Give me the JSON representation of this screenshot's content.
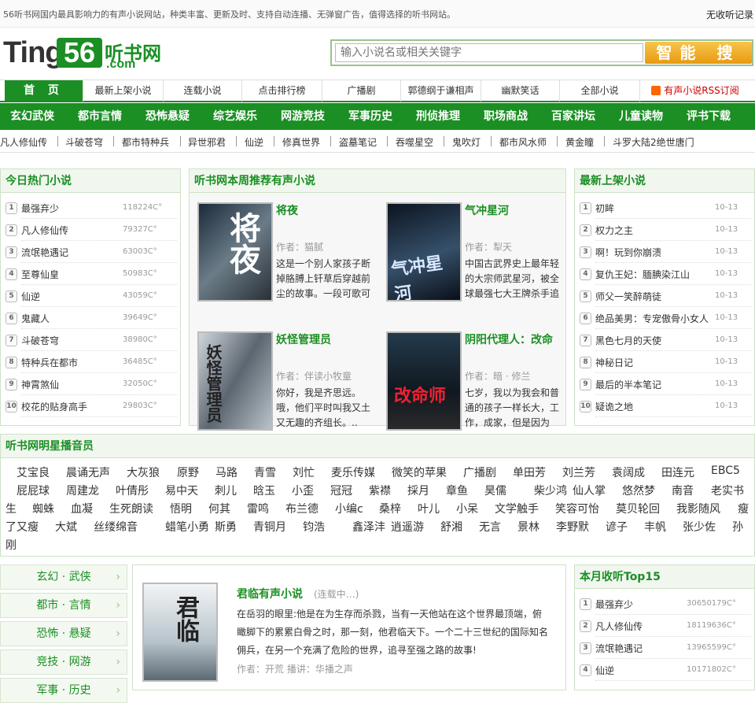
{
  "topbar": {
    "tagline": "56听书网国内最具影响力的有声小说网站，种类丰富、更新及时、支持自动连播、无弹窗广告，值得选择的听书网站。",
    "history": "无收听记录"
  },
  "logo": {
    "ting": "Ting",
    "num": "56",
    "cn": "听书网",
    "com": ".com"
  },
  "search": {
    "placeholder": "输入小说名或相关关键字",
    "button": "智能 搜索"
  },
  "nav_main": [
    "首 页",
    "最新上架小说",
    "连载小说",
    "点击排行榜",
    "广播剧",
    "郭德纲于谦相声",
    "幽默笑话",
    "全部小说",
    "有声小说RSS订阅"
  ],
  "nav_cats": [
    "玄幻武侠",
    "都市言情",
    "恐怖悬疑",
    "综艺娱乐",
    "网游竞技",
    "军事历史",
    "刑侦推理",
    "职场商战",
    "百家讲坛",
    "儿童读物",
    "评书下载"
  ],
  "nav_tags": [
    "凡人修仙传",
    "斗破苍穹",
    "都市特种兵",
    "异世邪君",
    "仙逆",
    "修真世界",
    "盗墓笔记",
    "吞噬星空",
    "鬼吹灯",
    "都市风水师",
    "黄金瞳",
    "斗罗大陆2绝世唐门"
  ],
  "hot": {
    "title": "今日热门小说",
    "items": [
      {
        "n": "1",
        "name": "最强弃少",
        "v": "118224C°"
      },
      {
        "n": "2",
        "name": "凡人修仙传",
        "v": "79327C°"
      },
      {
        "n": "3",
        "name": "流氓艳遇记",
        "v": "63003C°"
      },
      {
        "n": "4",
        "name": "至尊仙皇",
        "v": "50983C°"
      },
      {
        "n": "5",
        "name": "仙逆",
        "v": "43059C°"
      },
      {
        "n": "6",
        "name": "鬼藏人",
        "v": "39649C°"
      },
      {
        "n": "7",
        "name": "斗破苍穹",
        "v": "38980C°"
      },
      {
        "n": "8",
        "name": "特种兵在都市",
        "v": "36485C°"
      },
      {
        "n": "9",
        "name": "神霄煞仙",
        "v": "32050C°"
      },
      {
        "n": "10",
        "name": "校花的贴身高手",
        "v": "29803C°"
      }
    ]
  },
  "week": {
    "title": "听书网本周推荐有声小说",
    "books": [
      {
        "title": "将夜",
        "author": "作者：猫腻",
        "desc": "这是一个别人家孩子断掉胳膊上钎草后穿越前尘的故事。一段可歌可泣可笑可爱...",
        "cover_text": "将夜"
      },
      {
        "title": "气冲星河",
        "author": "作者：犁天",
        "desc": "中国古武界史上最年轻的大宗师武星河，被全球最强七大王牌杀手追杀，误中...",
        "cover_text": "气冲星河"
      },
      {
        "title": "妖怪管理员",
        "author": "作者：伴读小牧童",
        "desc": "你好，我是齐思远。哦，他们平时叫我又土又无趣的齐组长。..",
        "cover_text": "妖怪管理员"
      },
      {
        "title": "阴阳代理人：改命",
        "author": "作者：暗 · 修兰",
        "desc": "七岁，我以为我会和普通的孩子一样长大，工作，成家，但是因为误...",
        "cover_text": "改命师"
      }
    ]
  },
  "newest": {
    "title": "最新上架小说",
    "items": [
      {
        "n": "1",
        "name": "初眸",
        "v": "10-13"
      },
      {
        "n": "2",
        "name": "权力之主",
        "v": "10-13"
      },
      {
        "n": "3",
        "name": "啊！玩到你崩溃",
        "v": "10-13"
      },
      {
        "n": "4",
        "name": "复仇王妃：腼腆染江山",
        "v": "10-13"
      },
      {
        "n": "5",
        "name": "师父一笑醉萌徒",
        "v": "10-13"
      },
      {
        "n": "6",
        "name": "绝品美男：专宠傲骨小女人",
        "v": "10-13"
      },
      {
        "n": "7",
        "name": "黑色七月的天使",
        "v": "10-13"
      },
      {
        "n": "8",
        "name": "神秘日记",
        "v": "10-13"
      },
      {
        "n": "9",
        "name": "最后的半本笔记",
        "v": "10-13"
      },
      {
        "n": "10",
        "name": "疑诡之地",
        "v": "10-13"
      }
    ]
  },
  "stars": {
    "title": "听书网明星播音员",
    "names": [
      "艾宝良",
      "晨诵无声",
      "大灰狼",
      "原野",
      "马路",
      "青雪",
      "刘忙",
      "麦乐传媒",
      "微笑的苹果",
      "广播剧",
      "单田芳",
      "刘兰芳",
      "袁阔成",
      "田连元",
      "EBC5",
      "屁屁球",
      "周建龙",
      "叶倩彤",
      "易中天",
      "刺儿",
      "晗玉",
      "小歪",
      "冠冠",
      "紫襟",
      "採月",
      "章鱼",
      "昊儒",
      "柴少鸿",
      "仙人掌",
      "悠然梦",
      "南音",
      "老实书",
      "生",
      "蜘蛛",
      "血凝",
      "生死朗读",
      "悟明",
      "何其",
      "雷鸣",
      "布兰德",
      "小编c",
      "桑梓",
      "叶儿",
      "小呆",
      "文学触手",
      "笑容可怡",
      "莫贝轮回",
      "我影随风",
      "瘦",
      "了又瘦",
      "大斌",
      "丝缕绵音",
      "蜡笔小勇",
      "斯勇",
      "青铜月",
      "钧浩",
      "鑫泽沣",
      "逍遥游",
      "舒湘",
      "无言",
      "景林",
      "李野默",
      "谚子",
      "丰帆",
      "张少佐",
      "孙",
      "刚"
    ]
  },
  "leftnav": [
    "玄幻 · 武侠",
    "都市 · 言情",
    "恐怖 · 悬疑",
    "竞技 · 网游",
    "军事 · 历史"
  ],
  "feature": {
    "title": "君临有声小说",
    "status": "(连载中…)",
    "desc": "在岳羽的眼里:他是在为生存而杀戮，当有一天他站在这个世界最顶端，俯瞰脚下的累累白骨之时，那一刻，他君临天下。一个二十三世纪的国际知名佣兵，在另一个充满了危险的世界，追寻至强之路的故事!",
    "author": "作者：开荒  播讲：华播之声",
    "cover_text": "君临"
  },
  "month": {
    "title": "本月收听Top15",
    "items": [
      {
        "n": "1",
        "name": "最强弃少",
        "v": "30650179C°"
      },
      {
        "n": "2",
        "name": "凡人修仙传",
        "v": "18119636C°"
      },
      {
        "n": "3",
        "name": "流氓艳遇记",
        "v": "13965599C°"
      },
      {
        "n": "4",
        "name": "仙逆",
        "v": "10171802C°"
      }
    ]
  },
  "colors": {
    "brand": "#1b8f24",
    "search_button": "#f0a81f",
    "rss": "#cc0000"
  }
}
